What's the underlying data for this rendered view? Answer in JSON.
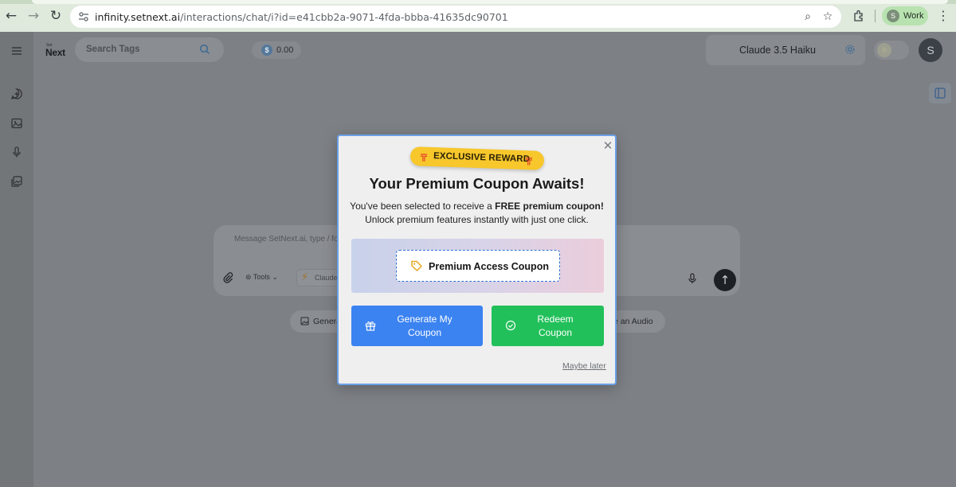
{
  "browser": {
    "url_domain": "infinity.setnext.ai",
    "url_path": "/interactions/chat/i?id=e41cbb2a-9071-4fda-bbba-41635dc90701",
    "profile_initial": "S",
    "profile_label": "Work"
  },
  "header": {
    "logo_small": "Set",
    "logo_big": "Next",
    "search_placeholder": "Search Tags",
    "balance_symbol": "$",
    "balance_value": "0.00",
    "model_name": "Claude 3.5 Haiku",
    "avatar_initial": "S"
  },
  "composer": {
    "placeholder": "Message SetNext.ai, type / fo",
    "tools_label": "Tools",
    "model_chip": "Claude"
  },
  "suggestions": [
    {
      "label": "Genera"
    },
    {
      "label": "e an Audio"
    }
  ],
  "modal": {
    "badge": "EXCLUSIVE REWARD",
    "title": "Your Premium Coupon Awaits!",
    "desc_line1_pre": "You've been selected to receive a ",
    "desc_line1_bold": "FREE premium coupon!",
    "desc_line2": "Unlock premium features instantly with just one click.",
    "coupon_label": "Premium Access Coupon",
    "generate_line1": "Generate My",
    "generate_line2": "Coupon",
    "redeem_line1": "Redeem",
    "redeem_line2": "Coupon",
    "maybe_later": "Maybe later"
  },
  "colors": {
    "primary_blue": "#3b83f1",
    "success_green": "#22c05a",
    "badge_yellow": "#f7c72b",
    "modal_border": "#6ba0e8"
  }
}
